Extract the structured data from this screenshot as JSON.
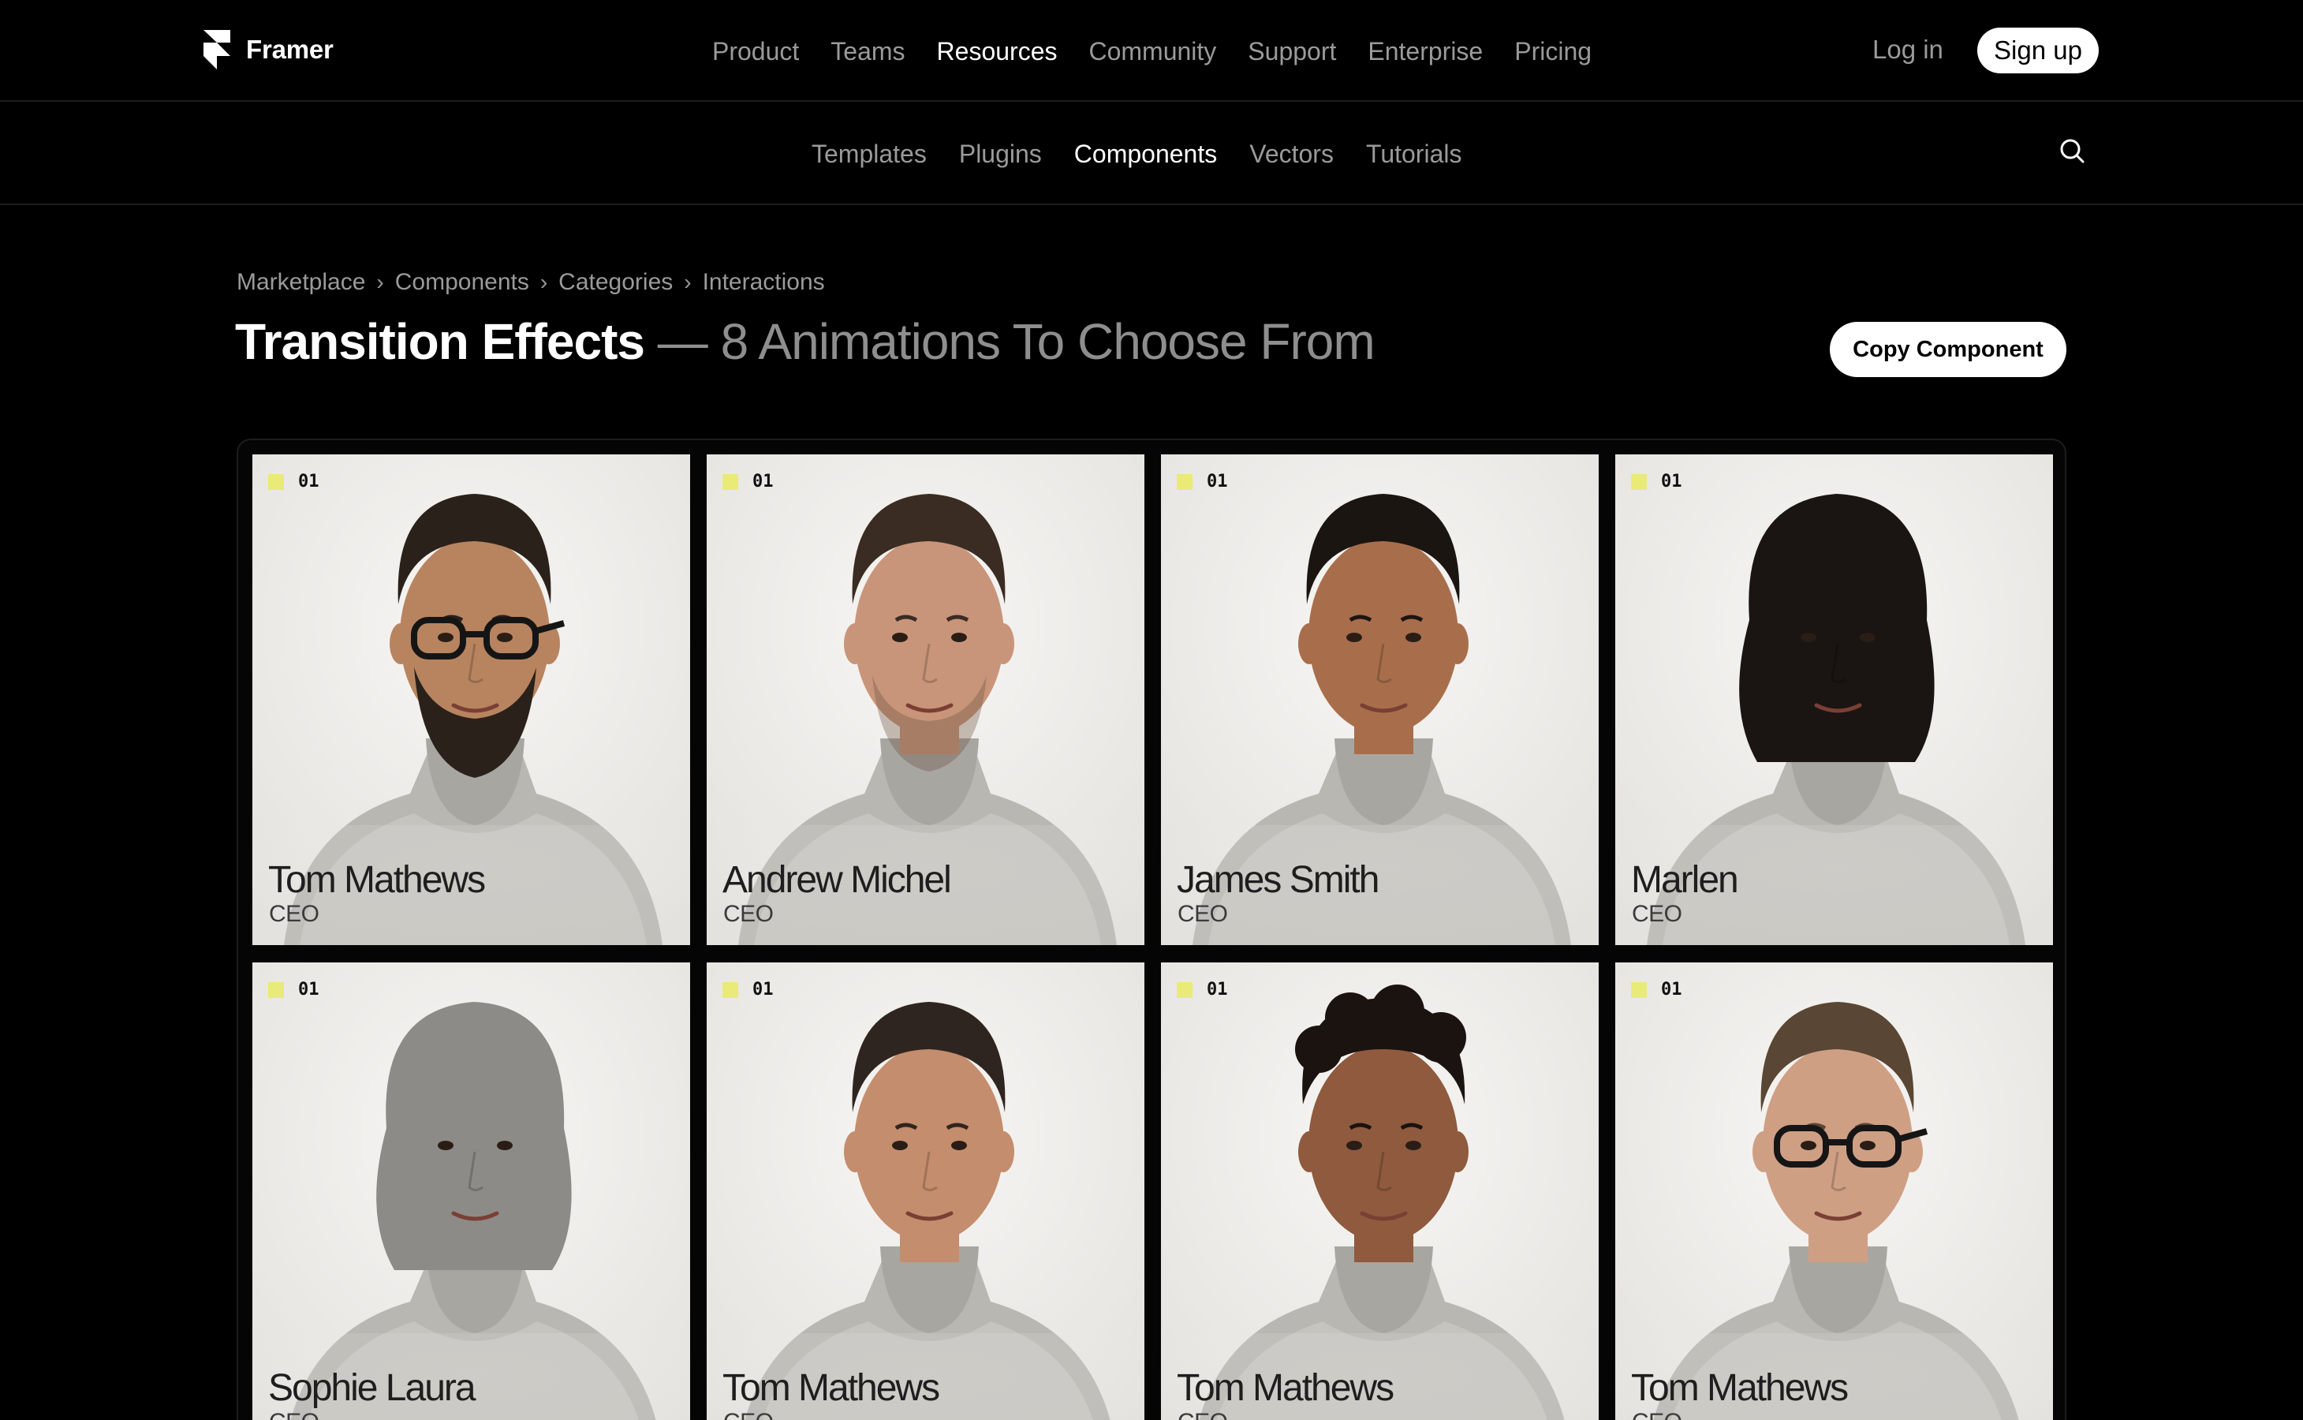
{
  "brand": {
    "name": "Framer"
  },
  "topnav": {
    "links": [
      {
        "label": "Product",
        "active": false
      },
      {
        "label": "Teams",
        "active": false
      },
      {
        "label": "Resources",
        "active": true
      },
      {
        "label": "Community",
        "active": false
      },
      {
        "label": "Support",
        "active": false
      },
      {
        "label": "Enterprise",
        "active": false
      },
      {
        "label": "Pricing",
        "active": false
      }
    ],
    "login_label": "Log in",
    "signup_label": "Sign up"
  },
  "subnav": {
    "links": [
      {
        "label": "Templates",
        "active": false
      },
      {
        "label": "Plugins",
        "active": false
      },
      {
        "label": "Components",
        "active": true
      },
      {
        "label": "Vectors",
        "active": false
      },
      {
        "label": "Tutorials",
        "active": false
      }
    ],
    "search_icon": "search-icon"
  },
  "breadcrumb": [
    "Marketplace",
    "Components",
    "Categories",
    "Interactions"
  ],
  "page": {
    "title_main": "Transition Effects",
    "title_sub": " — 8 Animations To Choose From",
    "copy_button": "Copy Component"
  },
  "cards": [
    {
      "index": "01",
      "name": "Tom Mathews",
      "role": "CEO",
      "hair": "#2a211b",
      "skin": "#b8845f",
      "style": "beard-glasses"
    },
    {
      "index": "01",
      "name": "Andrew Michel",
      "role": "CEO",
      "hair": "#3a2c22",
      "skin": "#c9957a",
      "style": "stubble"
    },
    {
      "index": "01",
      "name": "James Smith",
      "role": "CEO",
      "hair": "#1b1512",
      "skin": "#a86e4c",
      "style": "short"
    },
    {
      "index": "01",
      "name": "Marlen",
      "role": "CEO",
      "hair": "#1a1412",
      "skin": "#c08a68",
      "style": "long"
    },
    {
      "index": "01",
      "name": "Sophie Laura",
      "role": "CEO",
      "hair": "#8d8b87",
      "skin": "#d6a88c",
      "style": "long-gray"
    },
    {
      "index": "01",
      "name": "Tom Mathews",
      "role": "CEO",
      "hair": "#2f2520",
      "skin": "#c48d6d",
      "style": "short"
    },
    {
      "index": "01",
      "name": "Tom Mathews",
      "role": "CEO",
      "hair": "#1a1310",
      "skin": "#8f5a3e",
      "style": "curly"
    },
    {
      "index": "01",
      "name": "Tom Mathews",
      "role": "CEO",
      "hair": "#5a4634",
      "skin": "#cf9f84",
      "style": "glasses"
    }
  ]
}
